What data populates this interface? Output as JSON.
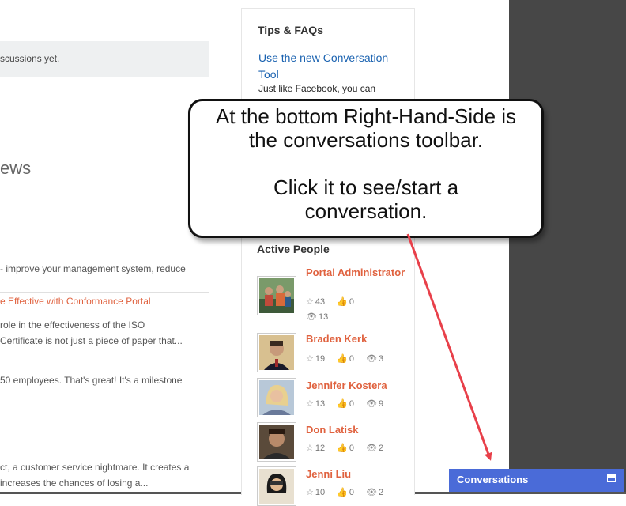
{
  "main": {
    "notice_text": "scussions yet.",
    "news_heading": "ews",
    "snippet_1": " - improve your management system, reduce",
    "article_link": "e Effective with Conformance Portal",
    "snippet_2_line1": " role in the effectiveness of the ISO",
    "snippet_2_line2": " Certificate is not just a piece of paper that...",
    "snippet_3": " 50 employees. That's great! It's a milestone",
    "snippet_4_line1": "ct, a customer service nightmare. It creates a",
    "snippet_4_line2": " increases the chances of losing a..."
  },
  "tips": {
    "title": "Tips & FAQs",
    "link": "Use the new Conversation Tool",
    "text": "Just like Facebook, you can"
  },
  "active_people": {
    "title": "Active People",
    "people": [
      {
        "name": "Portal Administrator",
        "stars": "43",
        "likes": "0",
        "views": "13"
      },
      {
        "name": "Braden Kerk",
        "stars": "19",
        "likes": "0",
        "views": "3"
      },
      {
        "name": "Jennifer Kostera",
        "stars": "13",
        "likes": "0",
        "views": "9"
      },
      {
        "name": "Don Latisk",
        "stars": "12",
        "likes": "0",
        "views": "2"
      },
      {
        "name": "Jenni Liu",
        "stars": "10",
        "likes": "0",
        "views": "2"
      }
    ]
  },
  "callout": {
    "line1": "At the bottom Right-Hand-Side is",
    "line2": "the conversations toolbar.",
    "line3": "Click it to see/start a",
    "line4": "conversation."
  },
  "conversations_bar": {
    "label": "Conversations"
  },
  "icons": {
    "star": "star-icon",
    "like": "thumbs-up-icon",
    "view": "eye-icon",
    "window": "window-icon"
  },
  "colors": {
    "accent_link": "#e0623f",
    "tips_link": "#1a62b0",
    "conversations_bar": "#4a6bd8",
    "arrow": "#e8404a"
  }
}
